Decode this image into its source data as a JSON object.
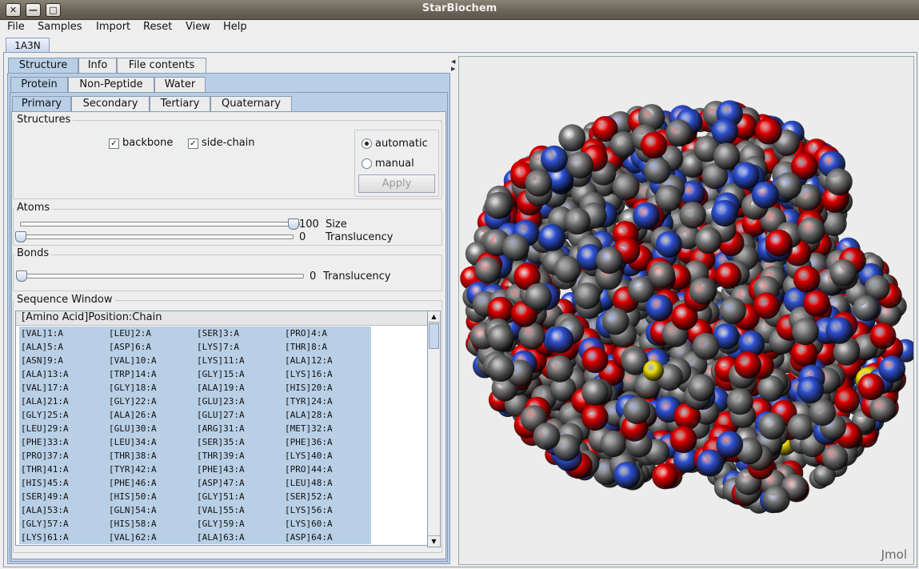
{
  "window": {
    "title": "StarBiochem",
    "close_glyph": "✕",
    "minimize_glyph": "—",
    "maximize_glyph": "□"
  },
  "menubar": [
    "File",
    "Samples",
    "Import",
    "Reset",
    "View",
    "Help"
  ],
  "document_tab": "1A3N",
  "tabs_main": [
    "Structure",
    "Info",
    "File contents"
  ],
  "tabs_molecule": [
    "Protein",
    "Non-Peptide",
    "Water"
  ],
  "tabs_structure": [
    "Primary",
    "Secondary",
    "Tertiary",
    "Quaternary"
  ],
  "structures": {
    "label": "Structures",
    "backbone_label": "backbone",
    "backbone_checked": true,
    "sidechain_label": "side-chain",
    "sidechain_checked": true,
    "automatic_label": "automatic",
    "manual_label": "manual",
    "selected_mode": "automatic",
    "apply_label": "Apply"
  },
  "atoms": {
    "label": "Atoms",
    "size_value": "100",
    "size_label": "Size",
    "size_fraction": 1.0,
    "translucency_value": "0",
    "translucency_label": "Translucency",
    "translucency_fraction": 0.0
  },
  "bonds": {
    "label": "Bonds",
    "translucency_value": "0",
    "translucency_label": "Translucency",
    "translucency_fraction": 0.0
  },
  "sequence": {
    "label": "Sequence Window",
    "header": "[Amino Acid]Position:Chain",
    "residues": [
      "[VAL]1:A",
      "[LEU]2:A",
      "[SER]3:A",
      "[PRO]4:A",
      "[ALA]5:A",
      "[ASP]6:A",
      "[LYS]7:A",
      "[THR]8:A",
      "[ASN]9:A",
      "[VAL]10:A",
      "[LYS]11:A",
      "[ALA]12:A",
      "[ALA]13:A",
      "[TRP]14:A",
      "[GLY]15:A",
      "[LYS]16:A",
      "[VAL]17:A",
      "[GLY]18:A",
      "[ALA]19:A",
      "[HIS]20:A",
      "[ALA]21:A",
      "[GLY]22:A",
      "[GLU]23:A",
      "[TYR]24:A",
      "[GLY]25:A",
      "[ALA]26:A",
      "[GLU]27:A",
      "[ALA]28:A",
      "[LEU]29:A",
      "[GLU]30:A",
      "[ARG]31:A",
      "[MET]32:A",
      "[PHE]33:A",
      "[LEU]34:A",
      "[SER]35:A",
      "[PHE]36:A",
      "[PRO]37:A",
      "[THR]38:A",
      "[THR]39:A",
      "[LYS]40:A",
      "[THR]41:A",
      "[TYR]42:A",
      "[PHE]43:A",
      "[PRO]44:A",
      "[HIS]45:A",
      "[PHE]46:A",
      "[ASP]47:A",
      "[LEU]48:A",
      "[SER]49:A",
      "[HIS]50:A",
      "[GLY]51:A",
      "[SER]52:A",
      "[ALA]53:A",
      "[GLN]54:A",
      "[VAL]55:A",
      "[LYS]56:A",
      "[GLY]57:A",
      "[HIS]58:A",
      "[GLY]59:A",
      "[LYS]60:A",
      "[LYS]61:A",
      "[VAL]62:A",
      "[ALA]63:A",
      "[ASP]64:A"
    ]
  },
  "viewer": {
    "watermark": "Jmol",
    "colors": {
      "carbon": "#7a7a7a",
      "oxygen": "#e00000",
      "nitrogen": "#2f52d6",
      "sulfur": "#f2e200"
    }
  }
}
